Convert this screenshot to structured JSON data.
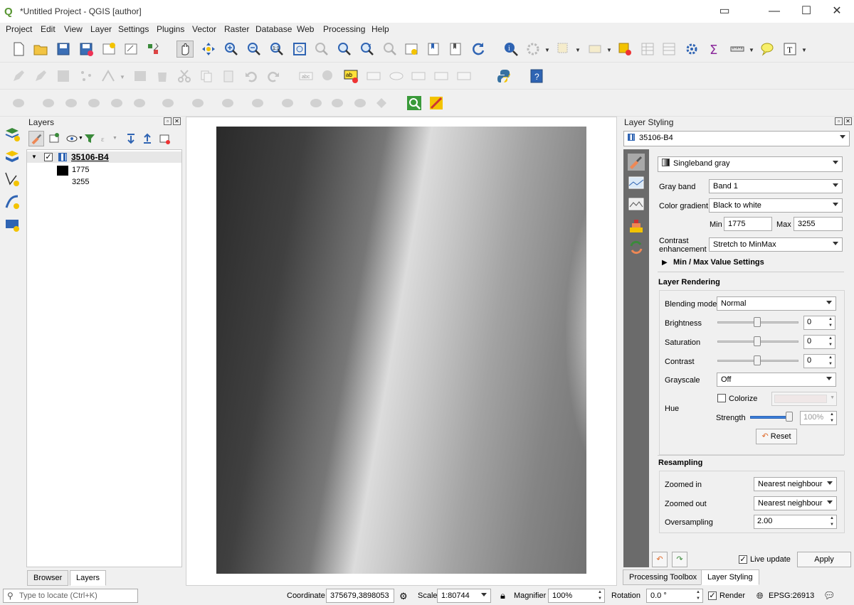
{
  "window": {
    "title": "*Untitled Project - QGIS [author]",
    "logo": "Q",
    "controls": {
      "minimize": "—",
      "maximize": "☐",
      "close": "✕",
      "extra": "▭"
    }
  },
  "menu": [
    "Project",
    "Edit",
    "View",
    "Layer",
    "Settings",
    "Plugins",
    "Vector",
    "Raster",
    "Database",
    "Web",
    "Processing",
    "Help"
  ],
  "layers_panel": {
    "title": "Layers",
    "layer_name": "35106-B4",
    "legend_min": "1775",
    "legend_max": "3255",
    "checked": "✓",
    "expand": "▼"
  },
  "styling": {
    "title": "Layer Styling",
    "layer_select": "35106-B4",
    "renderer": "Singleband gray",
    "gray_band_label": "Gray band",
    "gray_band": "Band 1",
    "color_gradient_label": "Color gradient",
    "color_gradient": "Black to white",
    "min_label": "Min",
    "min": "1775",
    "max_label": "Max",
    "max": "3255",
    "contrast_label_1": "Contrast",
    "contrast_label_2": "enhancement",
    "contrast": "Stretch to MinMax",
    "minmax_settings": "Min / Max Value Settings",
    "layer_rendering": "Layer Rendering",
    "blending_label": "Blending mode",
    "blending": "Normal",
    "brightness_label": "Brightness",
    "brightness": "0",
    "saturation_label": "Saturation",
    "saturation": "0",
    "contrast2_label": "Contrast",
    "contrast2": "0",
    "grayscale_label": "Grayscale",
    "grayscale": "Off",
    "hue_label": "Hue",
    "colorize_label": "Colorize",
    "strength_label": "Strength",
    "strength": "100%",
    "strength_level": 1.0,
    "reset": "Reset",
    "resampling": "Resampling",
    "zoomed_in_label": "Zoomed in",
    "zoomed_in": "Nearest neighbour",
    "zoomed_out_label": "Zoomed out",
    "zoomed_out": "Nearest neighbour",
    "oversampling_label": "Oversampling",
    "oversampling": "2.00",
    "live_update": "Live update",
    "live_checked": "✓",
    "apply": "Apply"
  },
  "bottom_tabs": {
    "browser": "Browser",
    "layers": "Layers",
    "processing": "Processing Toolbox",
    "layer_styling": "Layer Styling"
  },
  "status": {
    "locate_placeholder": "Type to locate (Ctrl+K)",
    "coordinate_label": "Coordinate",
    "coordinate": "375679,3898053",
    "scale_label": "Scale",
    "scale": "1:80744",
    "magnifier_label": "Magnifier",
    "magnifier": "100%",
    "rotation_label": "Rotation",
    "rotation": "0.0 °",
    "render_label": "Render",
    "render_checked": "✓",
    "crs": "EPSG:26913"
  },
  "colors": {
    "accent": "#589632",
    "dem_dark": "#2a2a2a",
    "dem_light": "#f4f4f4"
  }
}
